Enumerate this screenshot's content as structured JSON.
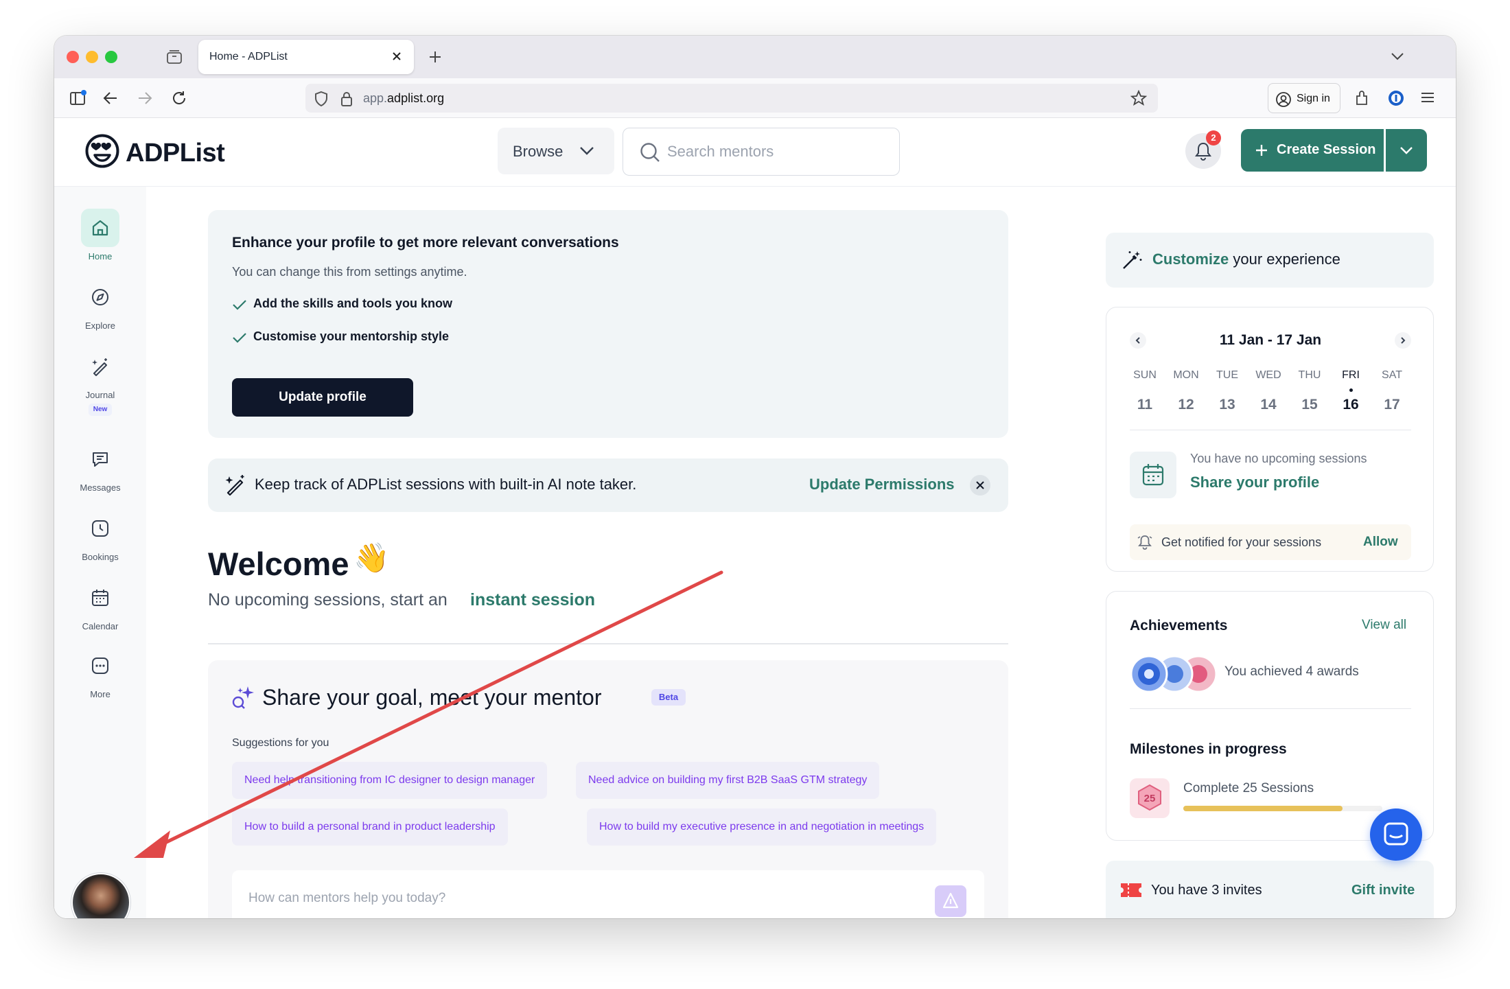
{
  "browser": {
    "tab_title": "Home - ADPList",
    "url_host": "app.",
    "url_domain": "adplist.org",
    "sign_in_label": "Sign in"
  },
  "header": {
    "logo_text": "ADPList",
    "browse_label": "Browse",
    "search_placeholder": "Search mentors",
    "notification_count": "2",
    "create_session_label": "Create Session"
  },
  "sidebar": {
    "items": [
      {
        "label": "Home"
      },
      {
        "label": "Explore"
      },
      {
        "label": "Journal",
        "badge": "New"
      },
      {
        "label": "Messages"
      },
      {
        "label": "Bookings"
      },
      {
        "label": "Calendar"
      },
      {
        "label": "More"
      }
    ]
  },
  "profile_card": {
    "title": "Enhance your profile to get more relevant conversations",
    "subtitle": "You can change this from settings anytime.",
    "checks": [
      "Add the skills and tools you know",
      "Customise your mentorship style"
    ],
    "button_label": "Update profile"
  },
  "ai_banner": {
    "text": "Keep track of ADPList sessions with built-in AI note taker.",
    "link": "Update Permissions"
  },
  "welcome": {
    "title": "Welcome",
    "emoji": "👋",
    "subtitle": "No upcoming sessions, start an",
    "link": "instant session"
  },
  "goal_card": {
    "title": "Share your goal, meet your mentor",
    "badge": "Beta",
    "suggestions_label": "Suggestions for you",
    "suggestions": [
      "Need help transitioning from IC designer to design manager",
      "Need advice on building my first B2B SaaS GTM strategy",
      "How to build a personal brand in product leadership",
      "How to build my executive presence in and negotiation in meetings"
    ],
    "input_placeholder": "How can mentors help you today?"
  },
  "customize": {
    "highlight": "Customize",
    "text": " your experience"
  },
  "calendar": {
    "range": "11 Jan - 17 Jan",
    "days": [
      {
        "name": "SUN",
        "num": "11"
      },
      {
        "name": "MON",
        "num": "12"
      },
      {
        "name": "TUE",
        "num": "13"
      },
      {
        "name": "WED",
        "num": "14"
      },
      {
        "name": "THU",
        "num": "15"
      },
      {
        "name": "FRI",
        "num": "16"
      },
      {
        "name": "SAT",
        "num": "17"
      }
    ],
    "today": "FRI",
    "no_sessions_text": "You have no upcoming sessions",
    "share_link": "Share your profile",
    "notify_text": "Get notified for your sessions",
    "notify_link": "Allow"
  },
  "achievements": {
    "title": "Achievements",
    "view_all": "View all",
    "awards_text": "You achieved 4 awards",
    "milestones_title": "Milestones in progress",
    "milestone_badge": "25",
    "milestone_label": "Complete 25 Sessions",
    "milestone_progress": 0.8
  },
  "invites": {
    "text": "You have 3 invites",
    "link": "Gift invite"
  },
  "colors": {
    "brand_green": "#2c7a6b",
    "annotation_red": "#e04848",
    "chat_blue": "#2563eb"
  }
}
